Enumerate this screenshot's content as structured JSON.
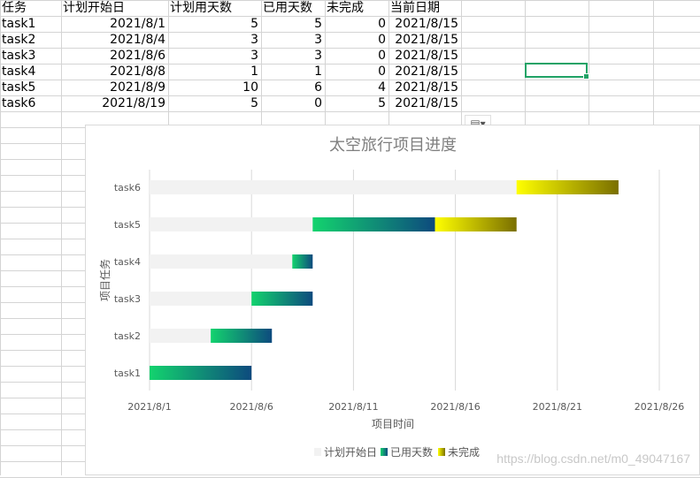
{
  "spreadsheet": {
    "headers": [
      "任务",
      "计划开始日",
      "计划用天数",
      "已用天数",
      "未完成",
      "当前日期"
    ],
    "rows": [
      [
        "task1",
        "2021/8/1",
        "5",
        "5",
        "0",
        "2021/8/15"
      ],
      [
        "task2",
        "2021/8/4",
        "3",
        "3",
        "0",
        "2021/8/15"
      ],
      [
        "task3",
        "2021/8/6",
        "3",
        "3",
        "0",
        "2021/8/15"
      ],
      [
        "task4",
        "2021/8/8",
        "1",
        "1",
        "0",
        "2021/8/15"
      ],
      [
        "task5",
        "2021/8/9",
        "10",
        "6",
        "4",
        "2021/8/15"
      ],
      [
        "task6",
        "2021/8/19",
        "5",
        "0",
        "5",
        "2021/8/15"
      ]
    ]
  },
  "colors": {
    "start_bar": "#f2f2f2",
    "used_start": "#13d36e",
    "used_end": "#0d4a7e",
    "remaining_start": "#ffff00",
    "remaining_end": "#7a6f00",
    "selection": "#21a366"
  },
  "chart_data": {
    "type": "bar",
    "orientation": "horizontal",
    "stacked": true,
    "title": "太空旅行项目进度",
    "xlabel": "项目时间",
    "ylabel": "项目任务",
    "categories": [
      "task1",
      "task2",
      "task3",
      "task4",
      "task5",
      "task6"
    ],
    "series": [
      {
        "name": "计划开始日",
        "values": [
          "2021/8/1",
          "2021/8/4",
          "2021/8/6",
          "2021/8/8",
          "2021/8/9",
          "2021/8/19"
        ]
      },
      {
        "name": "已用天数",
        "values": [
          5,
          3,
          3,
          1,
          6,
          0
        ]
      },
      {
        "name": "未完成",
        "values": [
          0,
          0,
          0,
          0,
          4,
          5
        ]
      }
    ],
    "xlim": [
      "2021/8/1",
      "2021/8/26"
    ],
    "xticks": [
      "2021/8/1",
      "2021/8/6",
      "2021/8/11",
      "2021/8/16",
      "2021/8/21",
      "2021/8/26"
    ],
    "grid": "vertical",
    "legend": "bottom"
  },
  "ui": {
    "paste_options_icon": "paste-options-icon",
    "watermark": "https://blog.csdn.net/m0_49047167"
  }
}
